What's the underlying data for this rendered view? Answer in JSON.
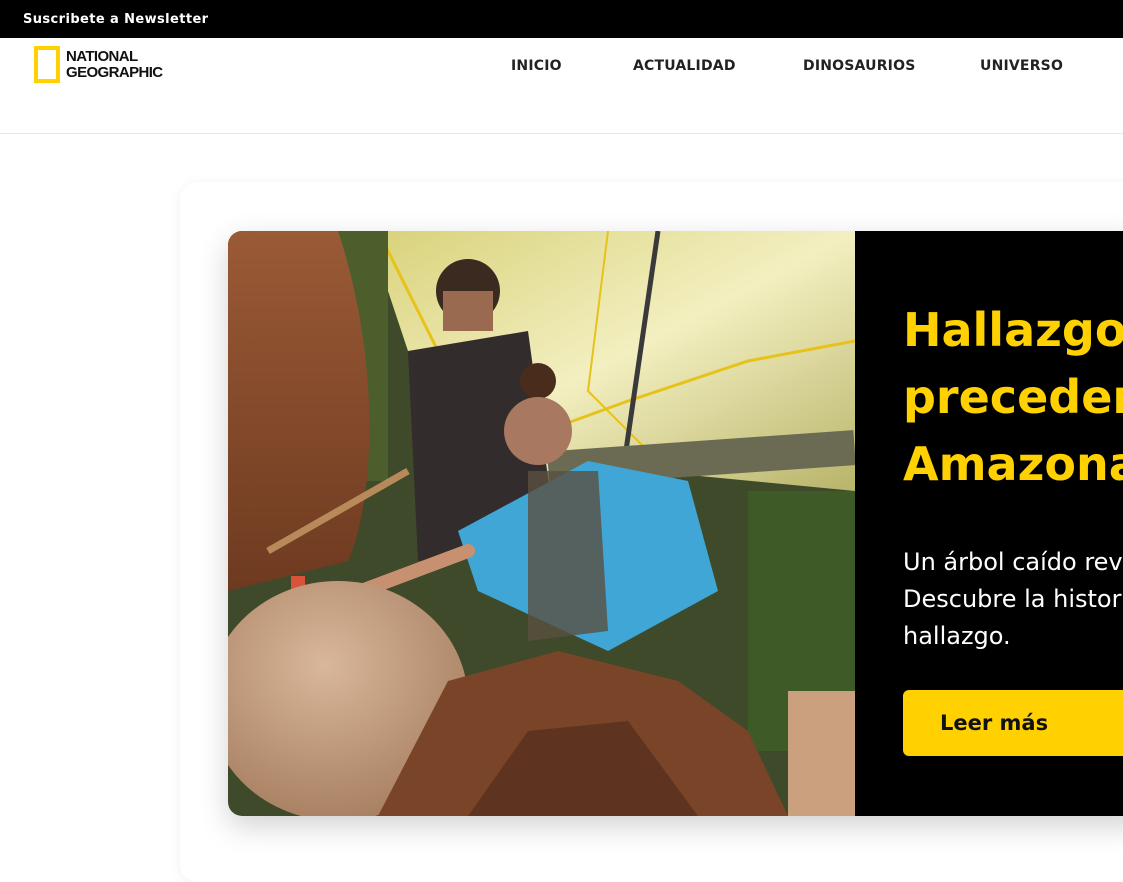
{
  "topbar": {
    "newsletter_link": "Suscribete a Newsletter"
  },
  "brand": {
    "logo_line1": "NATIONAL",
    "logo_line2": "GEOGRAPHIC"
  },
  "nav": {
    "items": [
      "INICIO",
      "ACTUALIDAD",
      "DINOSAURIOS",
      "UNIVERSO"
    ]
  },
  "hero": {
    "title": "Hallazgo\nprecedent\nAmazona",
    "description": "Un árbol caído rev\nDescubre la histor\nhallazgo.",
    "button_label": "Leer más",
    "photo_description": "Researchers excavating a large clay urn beneath a fallen tree in the Amazon"
  },
  "colors": {
    "accent": "#FFD100",
    "panel": "#000000",
    "topbar": "#000000"
  }
}
